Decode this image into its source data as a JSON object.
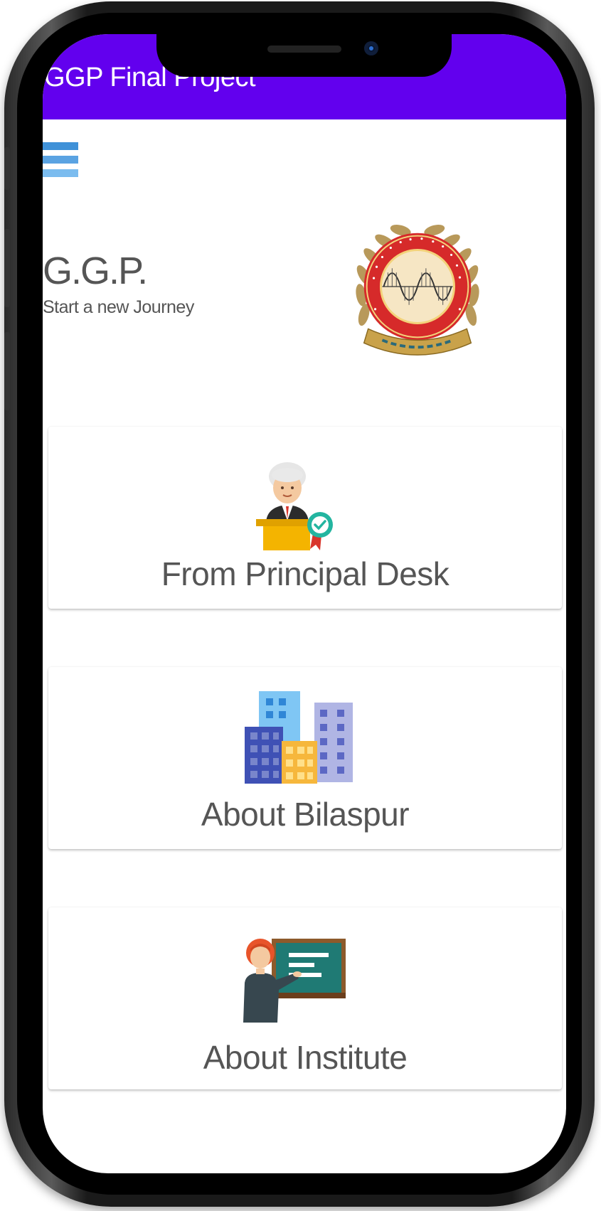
{
  "app_bar": {
    "title": "GGP Final Project",
    "color": "#6200ee"
  },
  "header": {
    "title": "G.G.P.",
    "subtitle": "Start a new Journey",
    "logo_icon": "college-emblem-icon"
  },
  "menu": {
    "icon": "hamburger-menu-icon"
  },
  "cards": [
    {
      "label": "From Principal Desk",
      "icon": "principal-podium-icon"
    },
    {
      "label": "About Bilaspur",
      "icon": "city-buildings-icon"
    },
    {
      "label": "About Institute",
      "icon": "teacher-board-icon"
    }
  ]
}
